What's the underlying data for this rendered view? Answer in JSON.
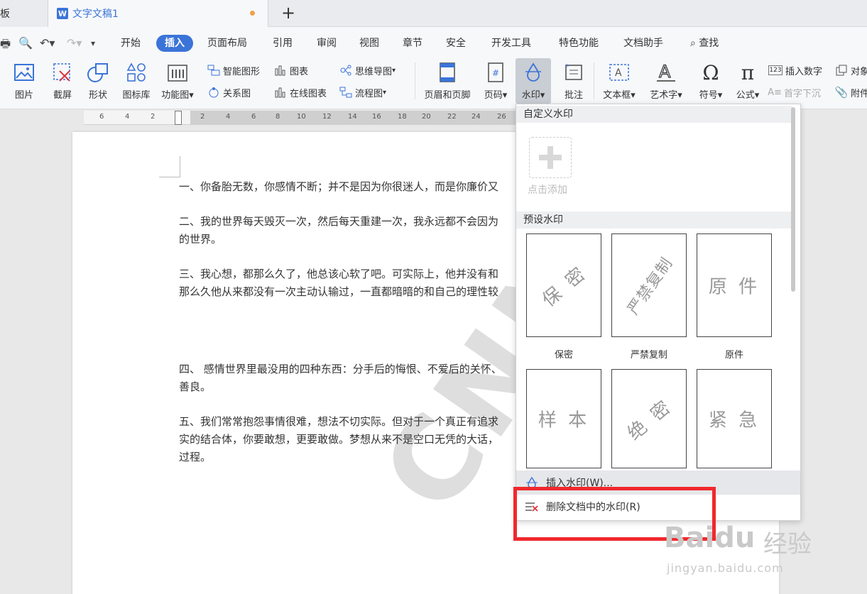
{
  "tabs": {
    "left_tab_label": "模板",
    "doc_icon_letter": "W",
    "active_tab_label": "文字文稿1",
    "new_tab": "+"
  },
  "menu": {
    "items": [
      "开始",
      "插入",
      "页面布局",
      "引用",
      "审阅",
      "视图",
      "章节",
      "安全",
      "开发工具",
      "特色功能",
      "文档助手",
      "查找"
    ],
    "active": "插入"
  },
  "ribbon": {
    "picture": "图片",
    "screenshot": "截屏",
    "shapes": "形状",
    "icon_lib": "图标库",
    "function_chart": "功能图",
    "smart_shape": "智能图形",
    "chart": "图表",
    "mind_map": "思维导图",
    "relation_chart": "关系图",
    "online_chart": "在线图表",
    "flowchart": "流程图",
    "header_footer": "页眉和页脚",
    "page_number": "页码",
    "watermark": "水印",
    "comment": "批注",
    "textbox": "文本框",
    "art_text": "艺术字",
    "symbol": "符号",
    "formula": "公式",
    "insert_number": "插入数字",
    "object": "对象",
    "drop_cap": "首字下沉",
    "attachment": "附件"
  },
  "ruler": {
    "ticks": [
      "6",
      "4",
      "2",
      "2",
      "4",
      "6",
      "8",
      "10",
      "12",
      "14",
      "16",
      "18",
      "20",
      "22",
      "24",
      "26"
    ]
  },
  "document": {
    "paragraphs": [
      "一、你备胎无数，你感情不断；并不是因为你很迷人，而是你廉价又",
      "二、我的世界每天毁灭一次，然后每天重建一次，我永远都不会因为",
      "的世界。",
      "三、我心想，都那么久了，他总该心软了吧。可实际上，他并没有和",
      "那么久他从来都没有一次主动认输过，一直都暗暗的和自己的理性较",
      "四、 感情世界里最没用的四种东西：分手后的悔恨、不爱后的关怀、",
      "善良。",
      "五、我们常常抱怨事情很难，想法不切实际。但对于一个真正有追求",
      "实的结合体，你要敢想，更要敢做。梦想从来不是空口无凭的大话，",
      "过程。"
    ],
    "background_watermark": "CNN"
  },
  "watermark_menu": {
    "custom_title": "自定义水印",
    "add_label": "点击添加",
    "preset_title": "预设水印",
    "presets": [
      {
        "text": "保 密",
        "label": "保密"
      },
      {
        "text": "严禁复制",
        "label": "严禁复制"
      },
      {
        "text": "原 件",
        "label": "原件"
      },
      {
        "text": "样 本",
        "label": "样本"
      },
      {
        "text": "绝 密",
        "label": "绝密"
      },
      {
        "text": "紧 急",
        "label": "紧急"
      }
    ],
    "insert_option": "插入水印(W)...",
    "delete_option": "删除文档中的水印(R)"
  },
  "site_watermark": {
    "logo_text": "Baidu",
    "logo_cn": "经验",
    "url": "jingyan.baidu.com"
  },
  "colors": {
    "accent": "#3b74d8",
    "highlight_red": "#f0282d"
  }
}
